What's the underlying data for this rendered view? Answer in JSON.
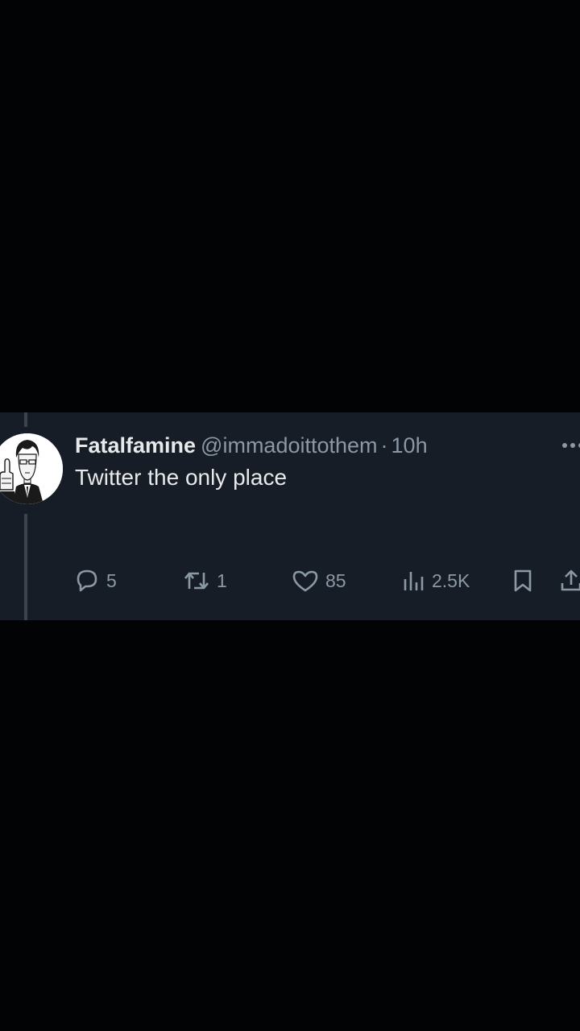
{
  "tweet": {
    "display_name": "Fatalfamine",
    "handle": "@immadoittothem",
    "separator": "·",
    "time": "10h",
    "text": "Twitter the only place"
  },
  "actions": {
    "replies": "5",
    "retweets": "1",
    "likes": "85",
    "views": "2.5K"
  },
  "icons": {
    "avatar": "avatar-anime-man-thumbs-up",
    "more": "more-dots-icon",
    "reply": "reply-bubble-icon",
    "retweet": "retweet-icon",
    "like": "heart-icon",
    "views": "views-bars-icon",
    "bookmark": "bookmark-icon",
    "share": "share-icon"
  },
  "colors": {
    "page_background": "#020305",
    "card_background": "#171d27",
    "primary_text": "#e7e9ea",
    "secondary_text": "#8b98a5",
    "thread_line": "#3a4350"
  }
}
